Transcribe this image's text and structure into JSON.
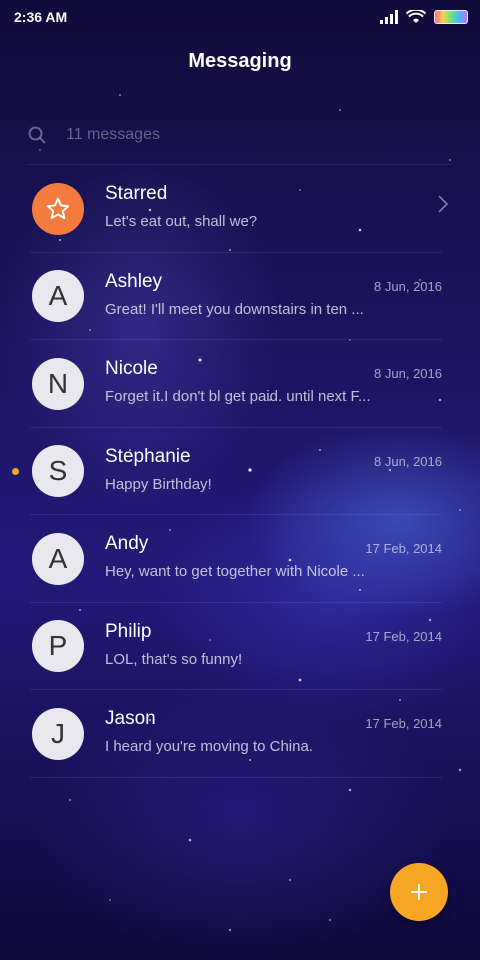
{
  "status_bar": {
    "time": "2:36 AM"
  },
  "header": {
    "title": "Messaging"
  },
  "search": {
    "placeholder": "11 messages"
  },
  "conversations": [
    {
      "name": "Starred",
      "snippet": "Let's eat out, shall we?",
      "date": "",
      "avatar": "star-icon"
    },
    {
      "name": "Ashley",
      "snippet": "Great! I'll meet you downstairs in ten ...",
      "date": "8 Jun, 2016",
      "avatar": "A"
    },
    {
      "name": "Nicole",
      "snippet": "Forget it.I don't bl get paid. until next F...",
      "date": "8 Jun, 2016",
      "avatar": "N"
    },
    {
      "name": "Stephanie",
      "snippet": "Happy Birthday!",
      "date": "8 Jun, 2016",
      "avatar": "S",
      "unread": true
    },
    {
      "name": "Andy",
      "snippet": "Hey, want to get together with Nicole ...",
      "date": "17 Feb, 2014",
      "avatar": "A"
    },
    {
      "name": "Philip",
      "snippet": "LOL, that's so funny!",
      "date": "17 Feb, 2014",
      "avatar": "P"
    },
    {
      "name": "Jason",
      "snippet": "I heard you're moving to China.",
      "date": "17 Feb, 2014",
      "avatar": "J"
    }
  ],
  "colors": {
    "accent": "#f6a623",
    "starred_avatar": "#f47b3d",
    "avatar_bg": "#e8e8ee"
  },
  "icons": {
    "fab": "plus-icon",
    "search": "search-icon",
    "chevron": "chevron-right-icon"
  }
}
